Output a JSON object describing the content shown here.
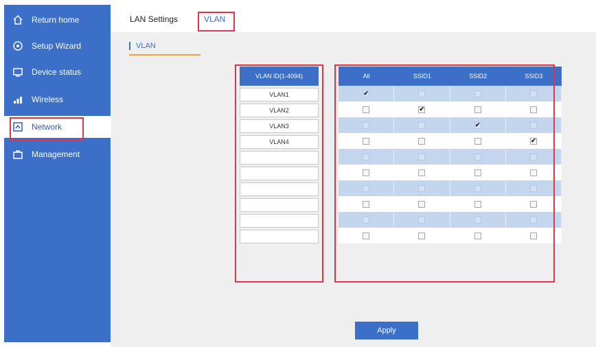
{
  "sidebar": {
    "items": [
      {
        "label": "Return home",
        "icon": "home-icon"
      },
      {
        "label": "Setup Wizard",
        "icon": "wizard-icon"
      },
      {
        "label": "Device status",
        "icon": "monitor-icon"
      },
      {
        "label": "Wireless",
        "icon": "signal-bars-icon"
      },
      {
        "label": "Network",
        "icon": "network-icon",
        "active": true
      },
      {
        "label": "Management",
        "icon": "briefcase-icon"
      }
    ]
  },
  "tabs": {
    "lan_settings": "LAN Settings",
    "vlan": "VLAN"
  },
  "main": {
    "subtab": "VLAN",
    "vlan_header": "VLAN ID(1-4094)",
    "vlan_ids": [
      "VLAN1",
      "VLAN2",
      "VLAN3",
      "VLAN4",
      "",
      "",
      "",
      "",
      "",
      ""
    ],
    "columns": [
      "All",
      "SSID1",
      "SSID2",
      "SSID3"
    ],
    "checked": [
      [
        true,
        false,
        false,
        false
      ],
      [
        false,
        true,
        false,
        false
      ],
      [
        false,
        false,
        true,
        false
      ],
      [
        false,
        false,
        false,
        true
      ],
      [
        false,
        false,
        false,
        false
      ],
      [
        false,
        false,
        false,
        false
      ],
      [
        false,
        false,
        false,
        false
      ],
      [
        false,
        false,
        false,
        false
      ],
      [
        false,
        false,
        false,
        false
      ],
      [
        false,
        false,
        false,
        false
      ]
    ],
    "check_glyph": "✔",
    "apply_label": "Apply"
  },
  "colors": {
    "accent": "#3b6fc8",
    "highlight": "#e0344a",
    "row_alt": "#c4d6ee"
  }
}
